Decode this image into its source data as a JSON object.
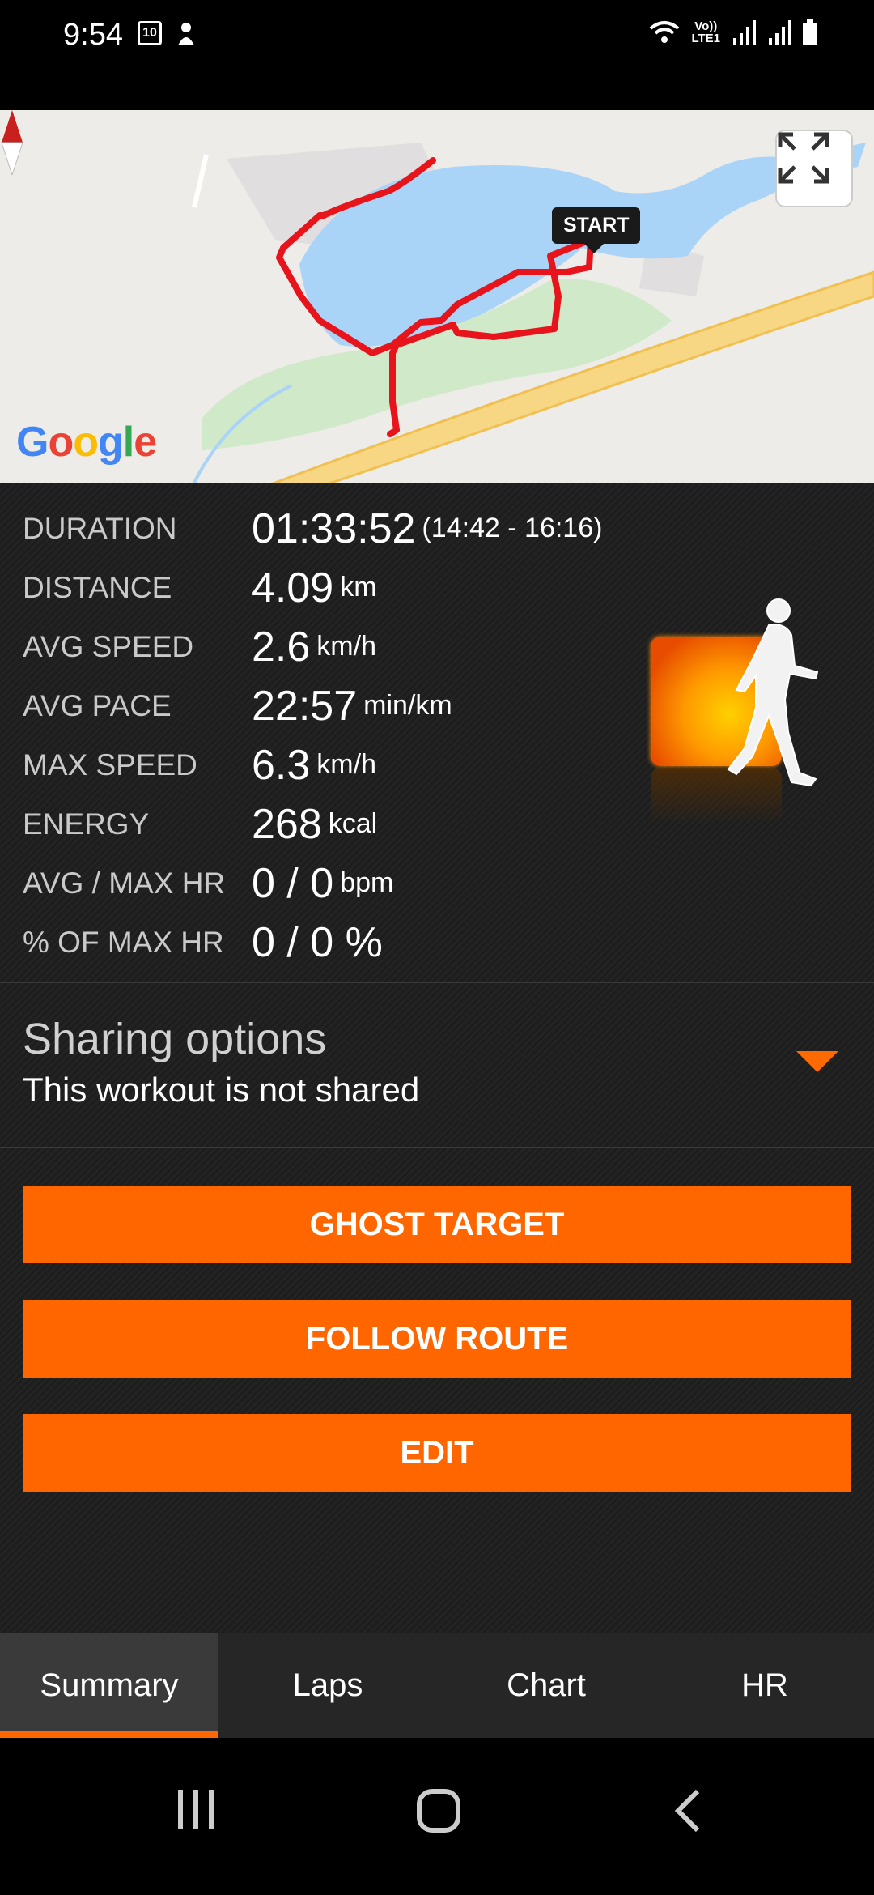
{
  "status_bar": {
    "time": "9:54",
    "calendar_day": "10",
    "network_label_top": "Vo))",
    "network_label_bottom": "LTE1"
  },
  "map": {
    "start_label": "START",
    "attribution": "Google",
    "route_color": "#e8141b",
    "water_color": "#aad4f7",
    "park_color": "#cfe9c9",
    "road_color": "#f7d684"
  },
  "stats": [
    {
      "label": "DURATION",
      "value": "01:33:52",
      "unit": "(14:42 - 16:16)"
    },
    {
      "label": "DISTANCE",
      "value": "4.09",
      "unit": "km"
    },
    {
      "label": "AVG SPEED",
      "value": "2.6",
      "unit": "km/h"
    },
    {
      "label": "AVG PACE",
      "value": "22:57",
      "unit": "min/km"
    },
    {
      "label": "MAX SPEED",
      "value": "6.3",
      "unit": "km/h"
    },
    {
      "label": "ENERGY",
      "value": "268",
      "unit": "kcal"
    },
    {
      "label": "AVG / MAX HR",
      "value": "0 / 0",
      "unit": "bpm"
    },
    {
      "label": "% OF MAX HR",
      "value": "0 / 0 %",
      "unit": ""
    }
  ],
  "sharing": {
    "title": "Sharing options",
    "subtitle": "This workout is not shared"
  },
  "buttons": {
    "ghost_target": "GHOST TARGET",
    "follow_route": "FOLLOW ROUTE",
    "edit": "EDIT"
  },
  "tabs": [
    {
      "label": "Summary",
      "active": true
    },
    {
      "label": "Laps",
      "active": false
    },
    {
      "label": "Chart",
      "active": false
    },
    {
      "label": "HR",
      "active": false
    }
  ],
  "accent_color": "#ff6600"
}
